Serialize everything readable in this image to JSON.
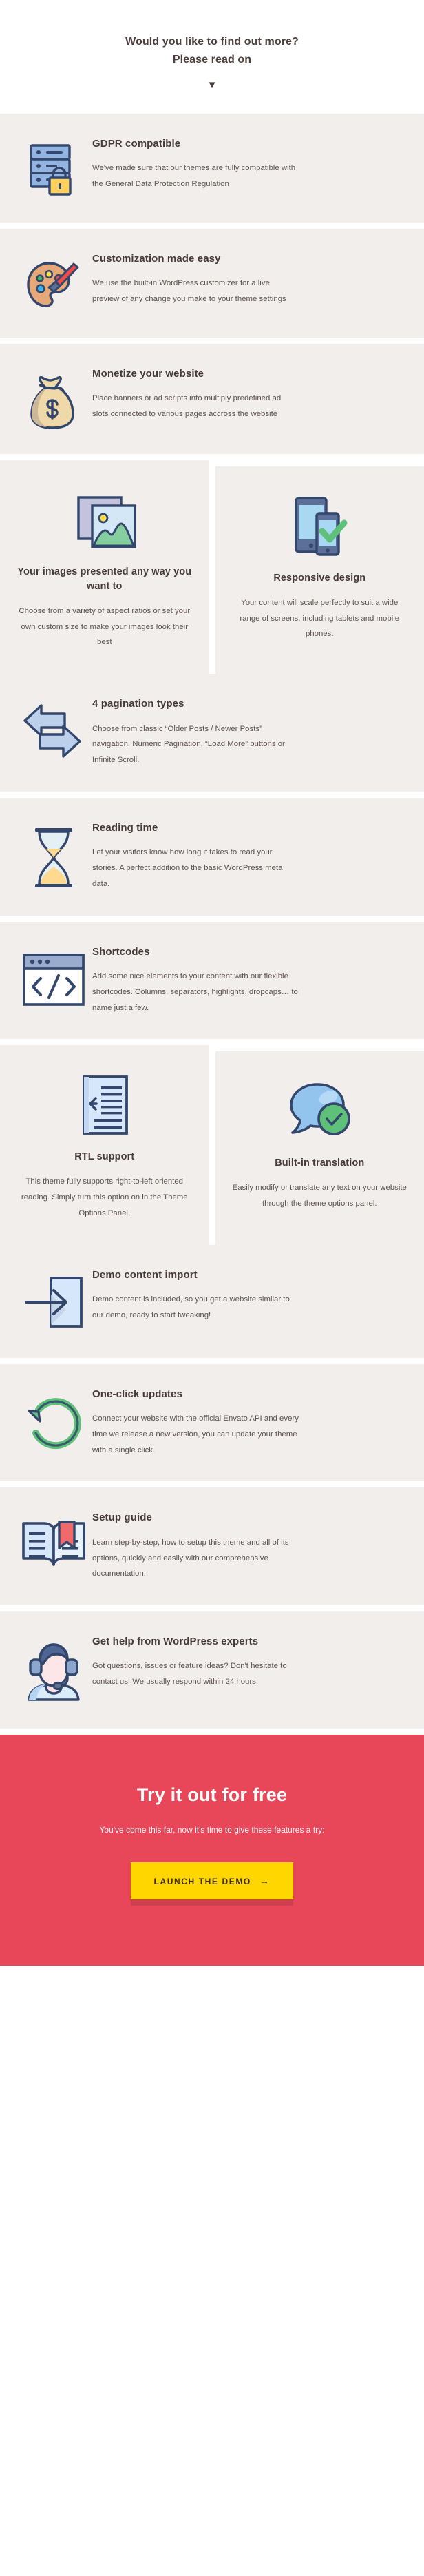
{
  "intro": {
    "line1": "Would you like to find out more?",
    "line2": "Please read on",
    "caret": "▼"
  },
  "colors": {
    "page_background": "#ffffff",
    "card_background": "#f2eeeb",
    "heading": "#463a38",
    "body_text": "#5d5350",
    "cta_background": "#e8475a",
    "cta_button": "#ffd600",
    "cta_button_text": "#3d2c10",
    "icon_outline": "#33466b",
    "icon_blue": "#93b3e0",
    "icon_green": "#5fc98a",
    "icon_yellow": "#ffd15c",
    "icon_red": "#ef6b6b"
  },
  "features": [
    {
      "icon": "server-lock-icon",
      "title": "GDPR compatible",
      "text": "We've made sure that our themes are fully compatible with the General Data Protection Regulation"
    },
    {
      "icon": "palette-brush-icon",
      "title": "Customization made easy",
      "text": "We use the built-in WordPress customizer for a live preview of any change you make to your theme settings"
    },
    {
      "icon": "money-bag-icon",
      "title": "Monetize your website",
      "text": "Place banners or ad scripts into multiply predefined ad slots connected to various pages accross the website"
    }
  ],
  "pair_one": [
    {
      "icon": "images-stack-icon",
      "title": "Your images presented any way you want to",
      "text": "Choose from a variety of aspect ratios or set your own custom size to make your images look their best"
    },
    {
      "icon": "responsive-devices-icon",
      "title": "Responsive design",
      "text": "Your content will scale perfectly to suit a wide range of screens, including tablets and mobile phones."
    }
  ],
  "features_two": [
    {
      "icon": "two-arrows-icon",
      "title": "4 pagination types",
      "text": "Choose from classic “Older Posts / Newer Posts” navigation, Numeric Pagination, “Load More” buttons or Infinite Scroll."
    },
    {
      "icon": "hourglass-icon",
      "title": "Reading time",
      "text": "Let your visitors know how long it takes to read your stories. A perfect addition to the basic WordPress meta data."
    },
    {
      "icon": "code-window-icon",
      "title": "Shortcodes",
      "text": "Add some nice elements to your content with our flexible shortcodes. Columns, separators, highlights, dropcaps… to name just a few."
    }
  ],
  "pair_two": [
    {
      "icon": "rtl-document-icon",
      "title": "RTL support",
      "text": "This theme fully supports right-to-left oriented reading. Simply turn this option on in the Theme Options Panel."
    },
    {
      "icon": "speech-bubble-check-icon",
      "title": "Built-in translation",
      "text": "Easily modify or translate any text on your website through the theme options panel."
    }
  ],
  "features_three": [
    {
      "icon": "import-arrow-icon",
      "title": "Demo content import",
      "text": "Demo content is included, so you get a website similar to our demo, ready to start tweaking!"
    },
    {
      "icon": "refresh-circle-icon",
      "title": "One-click updates",
      "text": "Connect your website with the official Envato API and every time we release a new version, you can update your theme with a single click."
    },
    {
      "icon": "open-book-icon",
      "title": "Setup guide",
      "text": "Learn step-by-step, how to setup this theme and all of its options, quickly and easily with our comprehensive documentation."
    },
    {
      "icon": "headset-support-icon",
      "title": "Get help from WordPress experts",
      "text": "Got questions, issues or feature ideas? Don't hesitate to contact us! We usually respond within 24 hours."
    }
  ],
  "cta": {
    "title": "Try it out for free",
    "subtitle": "You've come this far, now it's time to give these features a try:",
    "button_label": "LAUNCH THE DEMO",
    "button_arrow": "→"
  }
}
